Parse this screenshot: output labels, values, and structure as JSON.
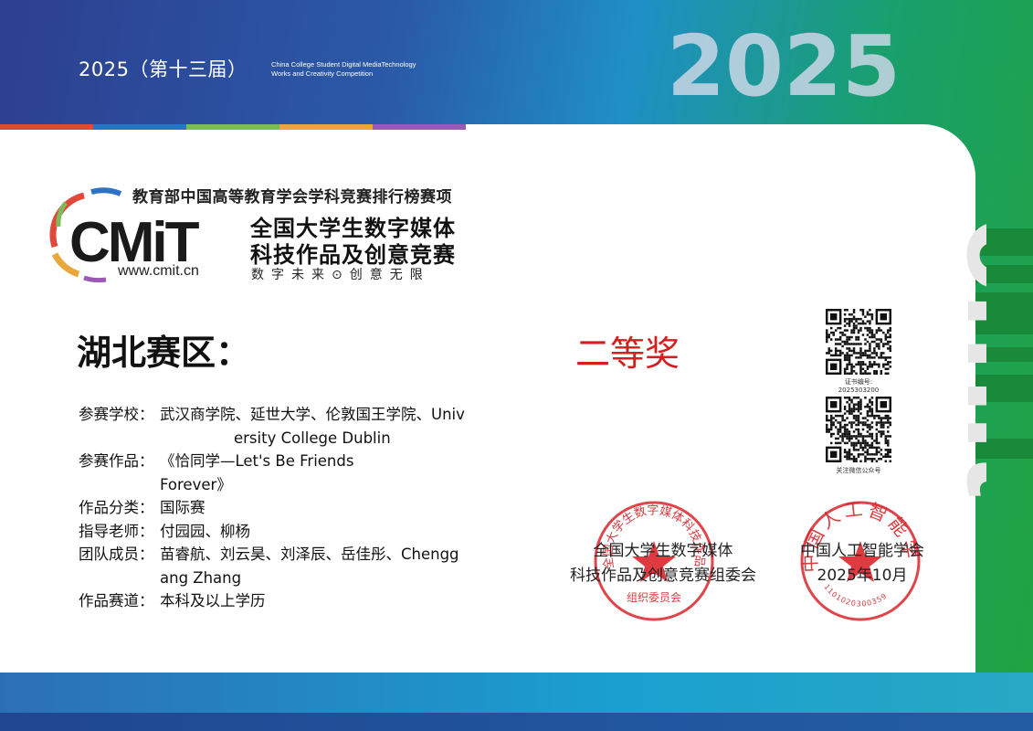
{
  "header": {
    "session": "2025（第十三届）",
    "english_name_line1": "China College Student Digital MediaTechnology",
    "english_name_line2": "Works and Creativity Competition",
    "year_graphic": "2025",
    "stripe_colors": [
      "#e0483a",
      "#2c73c7",
      "#7dbb5a",
      "#e8a63b",
      "#9b59b6"
    ]
  },
  "logo": {
    "top_line": "教育部中国高等教育学会学科竞赛排行榜赛项",
    "mark_text": "CMiT",
    "name_line1": "全国大学生数字媒体",
    "name_line2": "科技作品及创意竞赛",
    "url": "www.cmit.cn",
    "slogan": "数字未来⊙创意无限"
  },
  "certificate": {
    "region": "湖北赛区：",
    "award": "二等奖",
    "award_color": "#d51e1e",
    "fields": [
      {
        "key": "参赛学校：",
        "value": "武汉商学院、延世大学、伦敦国王学院、Univ",
        "cont": "ersity College Dublin"
      },
      {
        "key": "参赛作品：",
        "value": "《恰同学—Let's Be Friends",
        "cont": "Forever》"
      },
      {
        "key": "作品分类：",
        "value": "国际赛",
        "cont": ""
      },
      {
        "key": "指导老师：",
        "value": "付园园、柳杨",
        "cont": ""
      },
      {
        "key": "团队成员：",
        "value": "苗睿航、刘云昊、刘泽辰、岳佳彤、Chengg",
        "cont": "ang Zhang"
      },
      {
        "key": "作品赛道：",
        "value": "本科及以上学历",
        "cont": ""
      }
    ]
  },
  "qr": {
    "cert_no_label": "证书编号:",
    "cert_no": "2025303200",
    "wechat_label": "关注微信公众号"
  },
  "signatures": {
    "org1_line1": "全国大学生数字媒体",
    "org1_line2": "科技作品及创意竞赛组委会",
    "org2_line1": "中国人工智能学会",
    "org2_line2": "2025年10月",
    "seal1_text": "全国大学生数字媒体科技作品及创意竞赛",
    "seal1_bottom": "组织委员会",
    "seal2_text": "中国人工智能学会",
    "seal2_number": "1101020300359",
    "seal_color": "#d9262c"
  },
  "watermark": "cmit"
}
